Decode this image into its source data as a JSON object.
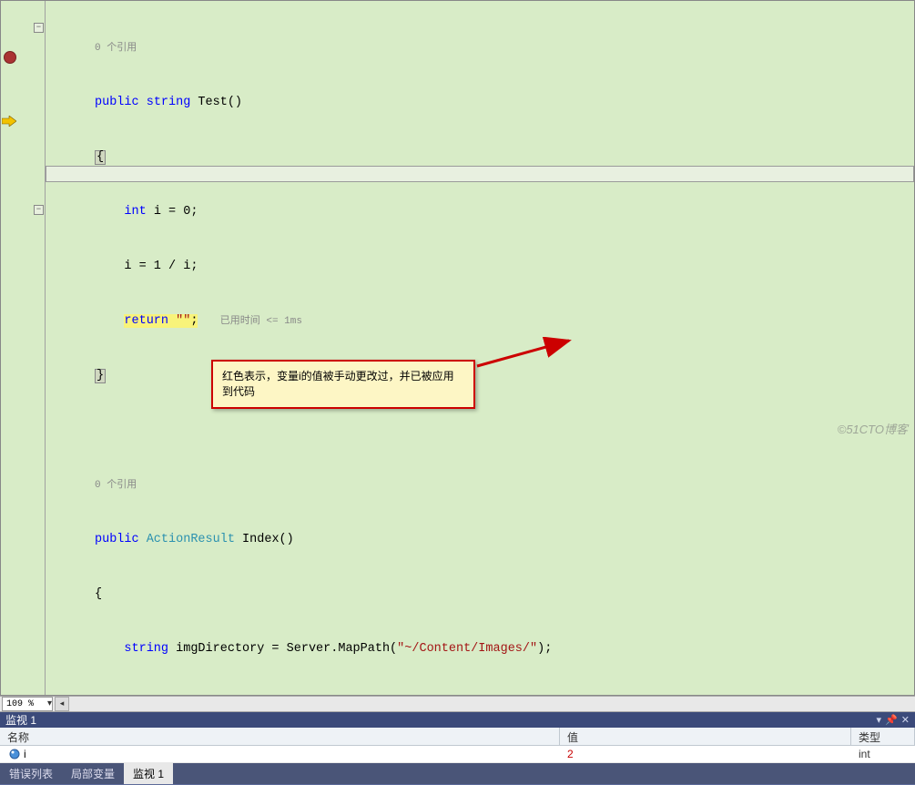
{
  "code": {
    "ref_hint_top": "0 个引用",
    "line1_kw1": "public",
    "line1_kw2": "string",
    "line1_method": " Test()",
    "line2_brace": "{",
    "line3_kw": "int",
    "line3_rest": " i = 0;",
    "line4": "i = 1 / i;",
    "line5_kw": "return",
    "line5_str": " \"\"",
    "line5_semi": ";",
    "line5_timing": "已用时间 <= 1ms",
    "line6_brace": "}",
    "ref_hint_2": "0 个引用",
    "line8_kw": "public",
    "line8_type": " ActionResult",
    "line8_method": " Index()",
    "line9_brace": "{",
    "line10_kw": "string",
    "line10_rest": " imgDirectory = Server.MapPath(",
    "line10_str": "\"~/Content/Images/\"",
    "line10_end": ");"
  },
  "zoom": {
    "value": "109 %"
  },
  "panel": {
    "title": "监视 1"
  },
  "watch": {
    "headers": {
      "name": "名称",
      "value": "值",
      "type": "类型"
    },
    "row": {
      "name": "i",
      "value": "2",
      "type": "int"
    }
  },
  "annotation": {
    "text": "红色表示，变量i的值被手动更改过，并已被应用到代码"
  },
  "tabs": {
    "t1": "错误列表",
    "t2": "局部变量",
    "t3": "监视 1"
  },
  "watermark": "©51CTO博客"
}
